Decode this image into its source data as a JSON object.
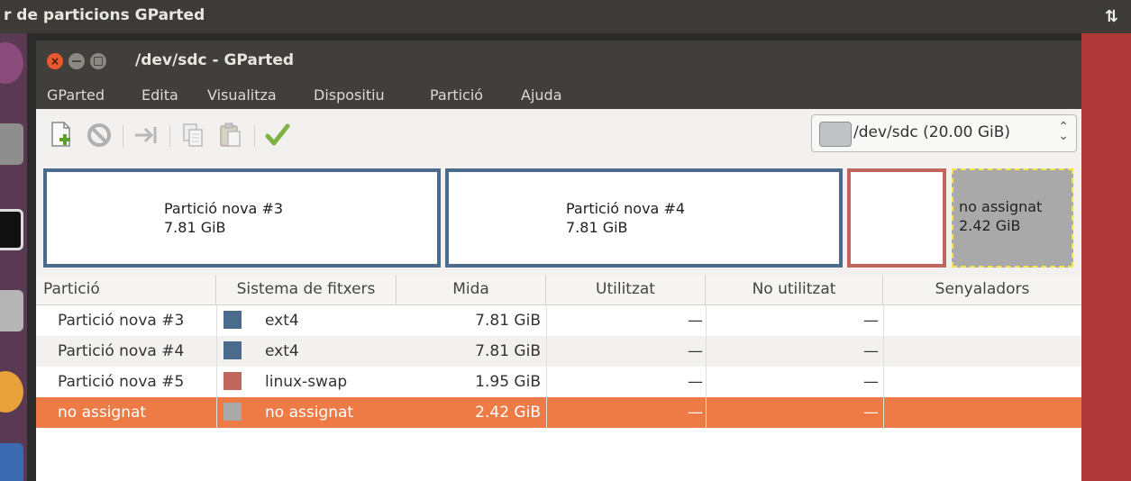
{
  "top_panel": {
    "title": "r de particions GParted",
    "network_icon": "updown-arrows-icon"
  },
  "window": {
    "title": "/dev/sdc - GParted"
  },
  "menu": [
    "GParted",
    "Edita",
    "Visualitza",
    "Dispositiu",
    "Partició",
    "Ajuda"
  ],
  "toolbar": {
    "icons": [
      "new-partition-icon",
      "delete-icon",
      "resize-move-icon",
      "copy-icon",
      "paste-icon",
      "apply-check-icon"
    ],
    "device_selector": "/dev/sdc  (20.00 GiB)"
  },
  "partition_map": [
    {
      "name": "Partició nova #3",
      "size": "7.81 GiB",
      "color": "#4a6b8c"
    },
    {
      "name": "Partició nova #4",
      "size": "7.81 GiB",
      "color": "#4a6b8c"
    },
    {
      "name": "",
      "size": "",
      "color": "#c0665c"
    },
    {
      "name": "no assignat",
      "size": "2.42 GiB",
      "color": "#a9a9a9"
    }
  ],
  "table": {
    "headers": [
      "Partició",
      "Sistema de fitxers",
      "Mida",
      "Utilitzat",
      "No utilitzat",
      "Senyaladors"
    ],
    "rows": [
      {
        "partition": "Partició nova #3",
        "fs_color": "#4a6b8c",
        "filesystem": "ext4",
        "size": "7.81 GiB",
        "used": "—",
        "unused": "—",
        "flags": ""
      },
      {
        "partition": "Partició nova #4",
        "fs_color": "#4a6b8c",
        "filesystem": "ext4",
        "size": "7.81 GiB",
        "used": "—",
        "unused": "—",
        "flags": ""
      },
      {
        "partition": "Partició nova #5",
        "fs_color": "#c0665c",
        "filesystem": "linux-swap",
        "size": "1.95 GiB",
        "used": "—",
        "unused": "—",
        "flags": ""
      },
      {
        "partition": "no assignat",
        "fs_color": "#a9a9a9",
        "filesystem": "no assignat",
        "size": "2.42 GiB",
        "used": "—",
        "unused": "—",
        "flags": ""
      }
    ],
    "selected_row": 3,
    "selected_color": "#ee7a45"
  }
}
